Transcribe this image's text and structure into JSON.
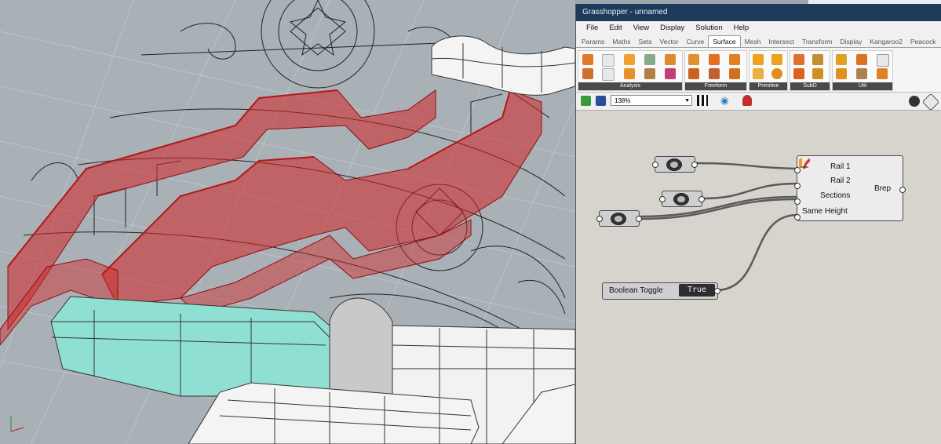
{
  "window": {
    "title": "Grasshopper - unnamed"
  },
  "menu": [
    "File",
    "Edit",
    "View",
    "Display",
    "Solution",
    "Help"
  ],
  "tabs": [
    "Params",
    "Maths",
    "Sets",
    "Vector",
    "Curve",
    "Surface",
    "Mesh",
    "Intersect",
    "Transform",
    "Display",
    "Kangaroo2",
    "Peacock"
  ],
  "active_tab": "Surface",
  "ribbon_groups": [
    "Analysis",
    "Freeform",
    "Primitive",
    "SubD",
    "Util"
  ],
  "toolbar": {
    "zoom": "138%"
  },
  "canvas": {
    "sweep": {
      "inputs": [
        "Rail 1",
        "Rail 2",
        "Sections",
        "Same Height"
      ],
      "output": "Brep"
    },
    "toggle": {
      "label": "Boolean Toggle",
      "value": "True"
    }
  },
  "colors": {
    "title_bar": "#1e3b5c",
    "red_surface": "#d32525",
    "teal_surface": "#8fe0d2",
    "canvas": "#d6d4cd"
  }
}
